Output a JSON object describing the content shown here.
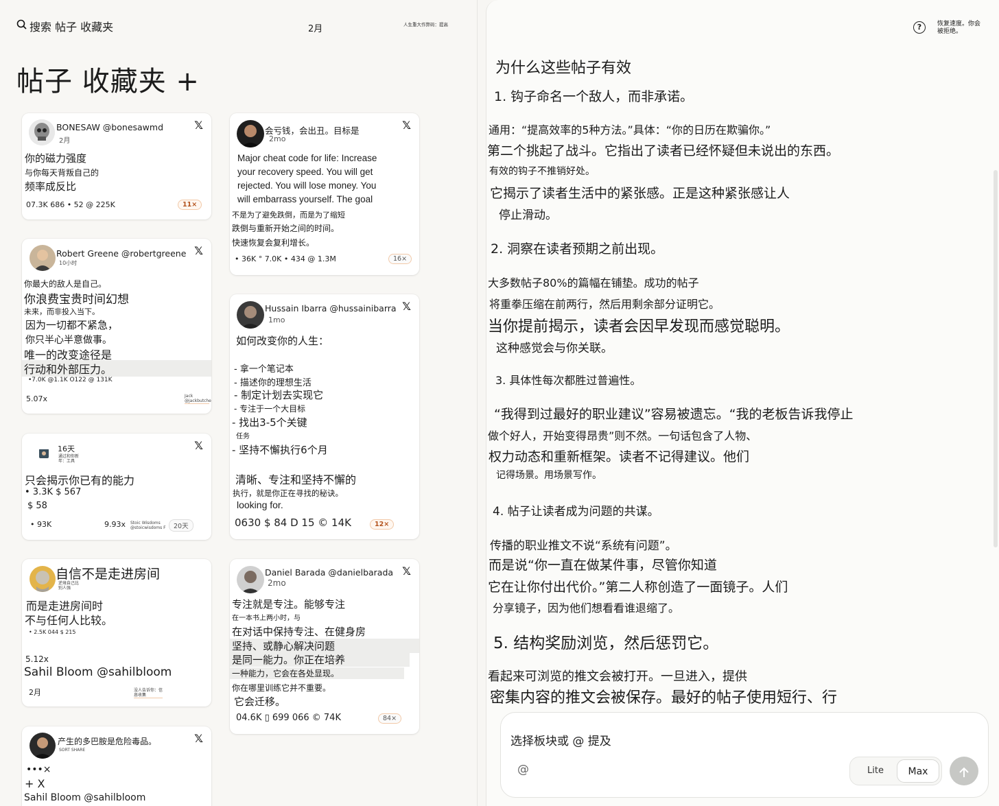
{
  "topbar": {
    "search_label": "搜索 帖子 收藏夹",
    "month": "2月",
    "note": "人生重大作弊码：提高"
  },
  "page_title": "帖子 收藏夹 +",
  "cards": {
    "c1": {
      "author": "BONESAW @bonesawmd",
      "time": "2月",
      "l1": "你的磁力强度",
      "l2": "与你每天背叛自己的",
      "l3": "频率成反比",
      "stats": "07.3K 686 • 52 @ 225K",
      "badge": "11×"
    },
    "c2": {
      "author": "Robert Greene @robertgreene",
      "time": "10小时",
      "l1": "你最大的敌人是自己。",
      "l2": "你浪费宝贵时间幻想",
      "l3": "未来，而非投入当下。",
      "l4": "因为一切都不紧急，",
      "l5": "你只半心半意做事。",
      "l6": "唯一的改变途径是",
      "l7": "行动和外部压力。",
      "stats": "•7.0K @1.1K O122 @ 131K",
      "mult": "5.07x",
      "tiny": "Jack @jackbutcher"
    },
    "c3": {
      "time": "16天",
      "tiny": "通过和你新年：工具",
      "l1": "只会揭示你已有的能力",
      "l2": "• 3.3K $ 567",
      "l3": "$ 58",
      "stats": "• 93K",
      "mult": "9.93x",
      "tiny2": "Stoic Wisdoms @stoicwisdoms F",
      "badge": "20天"
    },
    "c4": {
      "heading": "自信不是走进房间",
      "tiny": "逆境自己比别人强",
      "l1": "而是走进房间时",
      "l2": "不与任何人比较。",
      "stats": "• 2.5K 044 $ 215",
      "mult": "5.12x",
      "author": "Sahil Bloom @sahilbloom",
      "time": "2月",
      "tiny2": "没人告诉你：信息收集"
    },
    "c5": {
      "heading": "产生的多巴胺是危险毒品。",
      "tiny": "SORT SHARE",
      "l1": "•••×",
      "l2": "+ X",
      "author": "Sahil Bloom @sahilbloom"
    },
    "c6": {
      "author": "会亏钱，会出丑。目标是",
      "time": "2mo",
      "l1": "Major cheat code for life: Increase",
      "l2": "your recovery speed. You will get",
      "l3": "rejected. You will lose money. You",
      "l4": "will embarrass yourself. The goal",
      "l5": "不是为了避免跌倒，而是为了缩短",
      "l6": "跌倒与重新开始之间的时间。",
      "l7": "快速恢复会复利增长。",
      "stats": "• 36K °  7.0K • 434 @ 1.3M",
      "badge": "16×"
    },
    "c7": {
      "author": "Hussain Ibarra @hussainibarra",
      "time": "1mo",
      "l1": "如何改变你的人生：",
      "l2": "- 拿一个笔记本",
      "l3": "- 描述你的理想生活",
      "l4": "- 制定计划去实现它",
      "l5": "- 专注于一个大目标",
      "l6": "- 找出3-5个关键",
      "l7": "任务",
      "l8": "- 坚持不懈执行6个月",
      "l9": "清晰、专注和坚持不懈的",
      "l10": "执行，就是你正在寻找的秘诀。",
      "l11": "looking for.",
      "stats": "0630 $ 84 D 15 © 14K",
      "badge": "12×"
    },
    "c8": {
      "author": "Daniel Barada @danielbarada",
      "time": "2mo",
      "l1": "专注就是专注。能够专注",
      "l2": "在一本书上两小时，与",
      "l3": "在对话中保持专注、在健身房",
      "l4": "坚持、或静心解决问题",
      "l5": "是同一能力。你正在培养",
      "l6": "一种能力，它会在各处显现。",
      "l7": "你在哪里训练它并不重要。",
      "l8": "它会迁移。",
      "stats": "04.6K ▯  699 066 © 74K",
      "badge": "84×"
    }
  },
  "right": {
    "help_note": "恢复速度。你会被拒绝。",
    "heading": "为什么这些帖子有效",
    "lines": [
      "1. 钩子命名一个敌人，而非承诺。",
      "通用：“提高效率的5种方法。”具体：“你的日历在欺骗你。”",
      "第二个挑起了战斗。它指出了读者已经怀疑但未说出的东西。",
      "有效的钩子不推销好处。",
      "它揭示了读者生活中的紧张感。正是这种紧张感让人",
      "停止滑动。",
      "2. 洞察在读者预期之前出现。",
      "大多数帖子80%的篇幅在铺垫。成功的帖子",
      "将重拳压缩在前两行，然后用剩余部分证明它。",
      "当你提前揭示，读者会因早发现而感觉聪明。",
      "这种感觉会与你关联。",
      "3. 具体性每次都胜过普遍性。",
      "“我得到过最好的职业建议”容易被遗忘。“我的老板告诉我停止",
      "做个好人，开始变得昂贵”则不然。一句话包含了人物、",
      "权力动态和重新框架。读者不记得建议。他们",
      "记得场景。用场景写作。",
      "4. 帖子让读者成为问题的共谋。",
      "传播的职业推文不说“系统有问题”。",
      "而是说“你一直在做某件事，尽管你知道",
      "它在让你付出代价。”第二人称创造了一面镜子。人们",
      "分享镜子，因为他们想看看谁退缩了。",
      "5. 结构奖励浏览，然后惩罚它。",
      "看起来可浏览的推文会被打开。一旦进入，提供",
      "密集内容的推文会被保存。最好的帖子使用短行、行"
    ]
  },
  "composer": {
    "placeholder": "选择板块或 @ 提及",
    "mode_lite": "Lite",
    "mode_max": "Max"
  }
}
